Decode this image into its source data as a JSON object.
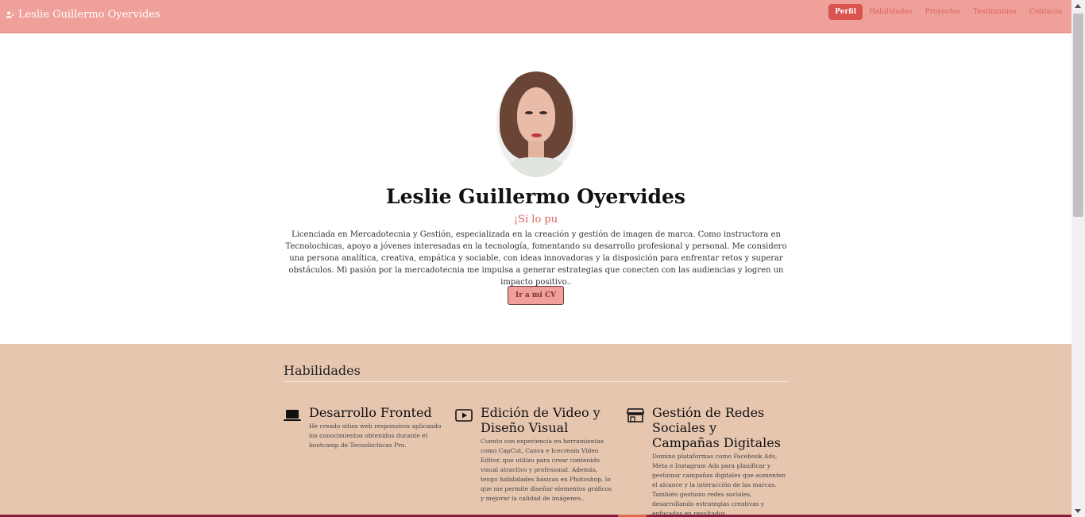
{
  "navbar": {
    "brand_icon": "user-icon",
    "brand": "Leslie Guillermo Oyervides",
    "links": [
      {
        "label": "Perfil",
        "active": true
      },
      {
        "label": "Habilidades",
        "active": false
      },
      {
        "label": "Proyectos",
        "active": false
      },
      {
        "label": "Testimonios",
        "active": false
      },
      {
        "label": "Contacto",
        "active": false
      }
    ]
  },
  "hero": {
    "name": "Leslie Guillermo Oyervides",
    "tagline": "¡Si lo pu",
    "bio": "Licenciada en Mercadotecnia y Gestión, especializada en la creación y gestión de imagen de marca. Como instructora en Tecnolochicas, apoyo a jóvenes interesadas en la tecnología, fomentando su desarrollo profesional y personal. Me considero una persona analítica, creativa, empática y sociable, con ideas innovadoras y la disposición para enfrentar retos y superar obstáculos. Mi pasión por la mercadotecnia me impulsa a generar estrategias que conecten con las audiencias y logren un impacto positivo..",
    "cv_button": "Ir a mi CV"
  },
  "skills": {
    "title": "Habilidades",
    "items": [
      {
        "icon": "laptop-icon",
        "title": "Desarrollo Fronted",
        "description": "He creado sitios web responsivos aplicando los conocimientos obtenidos durante el bootcamp de Tecnolochicas Pro."
      },
      {
        "icon": "play-icon",
        "title": "Edición de Video y Diseño Visual",
        "description": "Cuento con experiencia en herramientas como CapCut, Canva e Icecream Video Editor, que utilizo para crear contenido visual atractivo y profesional. Además, tengo habilidades básicas en Photoshop, lo que me permite diseñar elementos gráficos y mejorar la calidad de imágenes.."
      },
      {
        "icon": "shop-icon",
        "title": "Gestión de Redes Sociales y Campañas Digitales",
        "description": "Domino plataformas como Facebook Ads, Meta e Instagram Ads para planificar y gestionar campañas digitales que aumenten el alcance y la interacción de las marcas. También gestiono redes sociales, desarrollando estrategias creativas y enfocadas en resultados."
      }
    ]
  },
  "colors": {
    "navbar": "#f0a09a",
    "active_link": "#d9534f",
    "accent_text": "#d9635d",
    "skills_bg": "#e7c6b0",
    "bottom_bar": "#8b1c3b"
  }
}
